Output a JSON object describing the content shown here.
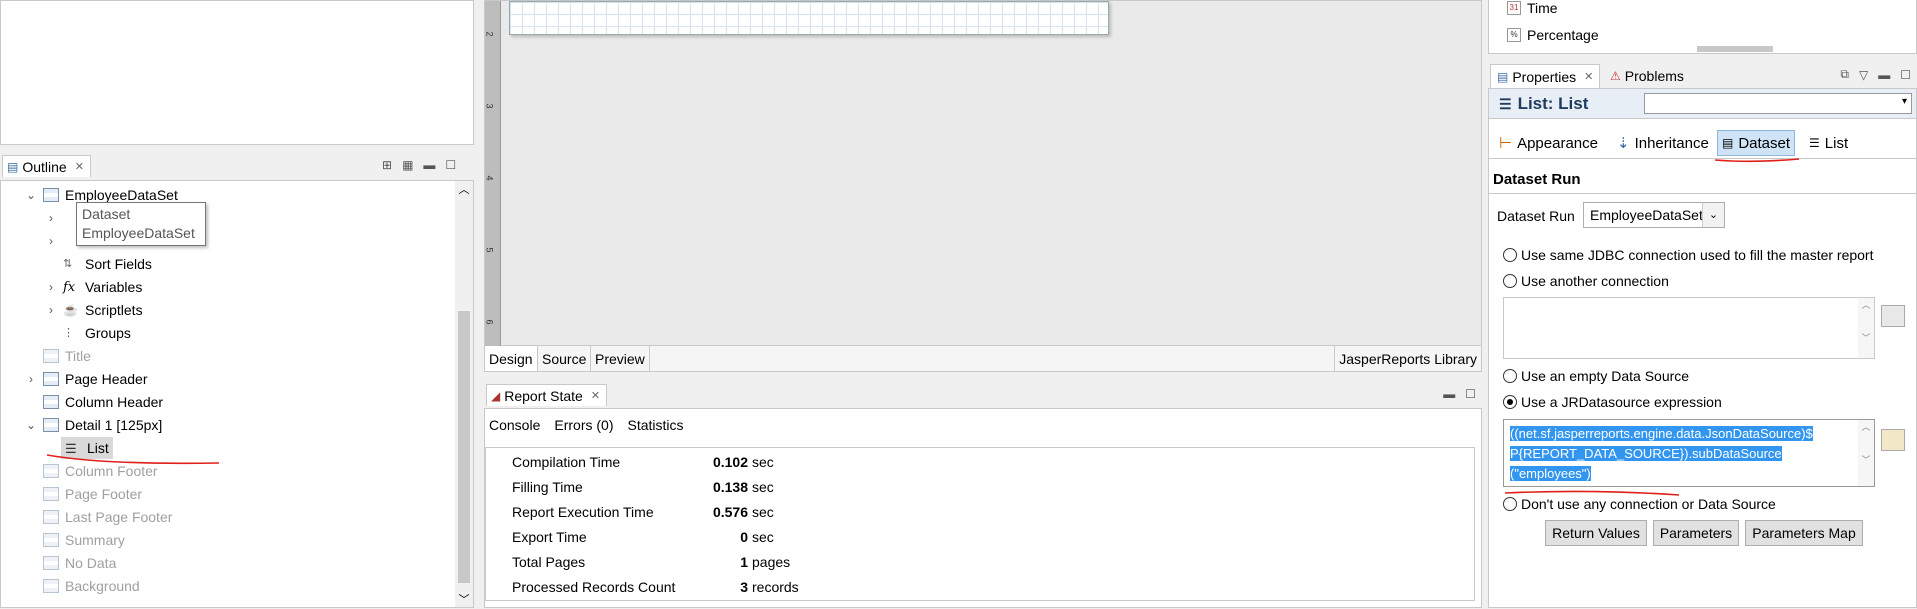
{
  "outline": {
    "tab_label": "Outline",
    "tooltip": {
      "line1": "Dataset",
      "line2": "EmployeeDataSet"
    },
    "tree": {
      "dataset": "EmployeeDataSet",
      "sort_fields": "Sort Fields",
      "variables": "Variables",
      "scriptlets": "Scriptlets",
      "groups": "Groups",
      "title": "Title",
      "page_header": "Page Header",
      "column_header": "Column Header",
      "detail": "Detail 1 [125px]",
      "list": "List",
      "column_footer": "Column Footer",
      "page_footer": "Page Footer",
      "last_page_footer": "Last Page Footer",
      "summary": "Summary",
      "no_data": "No Data",
      "background": "Background"
    }
  },
  "editor": {
    "ruler_marks": [
      "2",
      "3",
      "4",
      "5",
      "6"
    ],
    "tabs": {
      "design": "Design",
      "source": "Source",
      "preview": "Preview"
    },
    "library": "JasperReports Library"
  },
  "report_state": {
    "tab_label": "Report State",
    "subtabs": {
      "console": "Console",
      "errors": "Errors (0)",
      "statistics": "Statistics"
    },
    "stats": [
      {
        "label": "Compilation Time",
        "value": "0.102",
        "unit": "sec"
      },
      {
        "label": "Filling Time",
        "value": "0.138",
        "unit": "sec"
      },
      {
        "label": "Report Execution Time",
        "value": "0.576",
        "unit": "sec"
      },
      {
        "label": "Export Time",
        "value": "0",
        "unit": "sec"
      },
      {
        "label": "Total Pages",
        "value": "1",
        "unit": "pages"
      },
      {
        "label": "Processed Records Count",
        "value": "3",
        "unit": "records"
      }
    ]
  },
  "palette": {
    "items": [
      {
        "label": "Time",
        "icon": "calendar-icon"
      },
      {
        "label": "Percentage",
        "icon": "percent-icon"
      }
    ]
  },
  "properties": {
    "tabs": {
      "properties": "Properties",
      "problems": "Problems"
    },
    "header_title": "List: List",
    "combo_value": "",
    "section_tabs": {
      "appearance": "Appearance",
      "inheritance": "Inheritance",
      "dataset": "Dataset",
      "list": "List"
    },
    "section_title": "Dataset Run",
    "dataset_run_label": "Dataset Run",
    "dataset_run_value": "EmployeeDataSet",
    "radios": {
      "same_jdbc": "Use same JDBC connection used to fill the master report",
      "another_connection": "Use another connection",
      "empty_ds": "Use an empty Data Source",
      "jr_expression": "Use a JRDatasource expression",
      "no_connection": "Don't use any connection or Data Source"
    },
    "selected_radio": "jr_expression",
    "expression_lines": [
      "((net.sf.jasperreports.engine.data.JsonDataSource)$",
      "P{REPORT_DATA_SOURCE}).subDataSource",
      "(\"employees\")"
    ],
    "buttons": {
      "return_values": "Return Values",
      "parameters": "Parameters",
      "parameters_map": "Parameters Map"
    },
    "annotation_color": "#e0201a"
  }
}
